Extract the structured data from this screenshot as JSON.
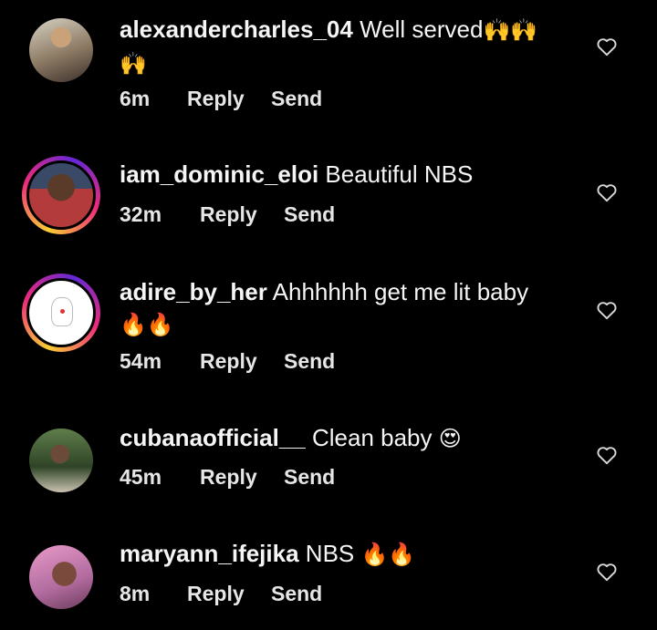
{
  "comments": [
    {
      "username": "alexandercharles_04",
      "text": "Well served",
      "emoji_line1": "🙌🙌",
      "emoji_line2": "🙌",
      "time": "6m",
      "reply_label": "Reply",
      "send_label": "Send",
      "avatar_ring": false
    },
    {
      "username": "iam_dominic_eloi",
      "text": "Beautiful NBS",
      "time": "32m",
      "reply_label": "Reply",
      "send_label": "Send",
      "avatar_ring": true
    },
    {
      "username": "adire_by_her",
      "text": "Ahhhhhh get me lit baby",
      "emoji_line2": "🔥🔥",
      "time": "54m",
      "reply_label": "Reply",
      "send_label": "Send",
      "avatar_ring": true
    },
    {
      "username": "cubanaofficial__",
      "text": "Clean baby",
      "emoji_line1": "😍",
      "time": "45m",
      "reply_label": "Reply",
      "send_label": "Send",
      "avatar_ring": false
    },
    {
      "username": "maryann_ifejika",
      "text": "NBS",
      "emoji_line1": "🔥🔥",
      "time": "8m",
      "reply_label": "Reply",
      "send_label": "Send",
      "avatar_ring": false
    }
  ],
  "icons": {
    "like": "heart-outline-icon"
  },
  "colors": {
    "background": "#000000",
    "text": "#f5f5f5",
    "ring_start": "#f9ce34",
    "ring_mid": "#ee2a7b"
  }
}
